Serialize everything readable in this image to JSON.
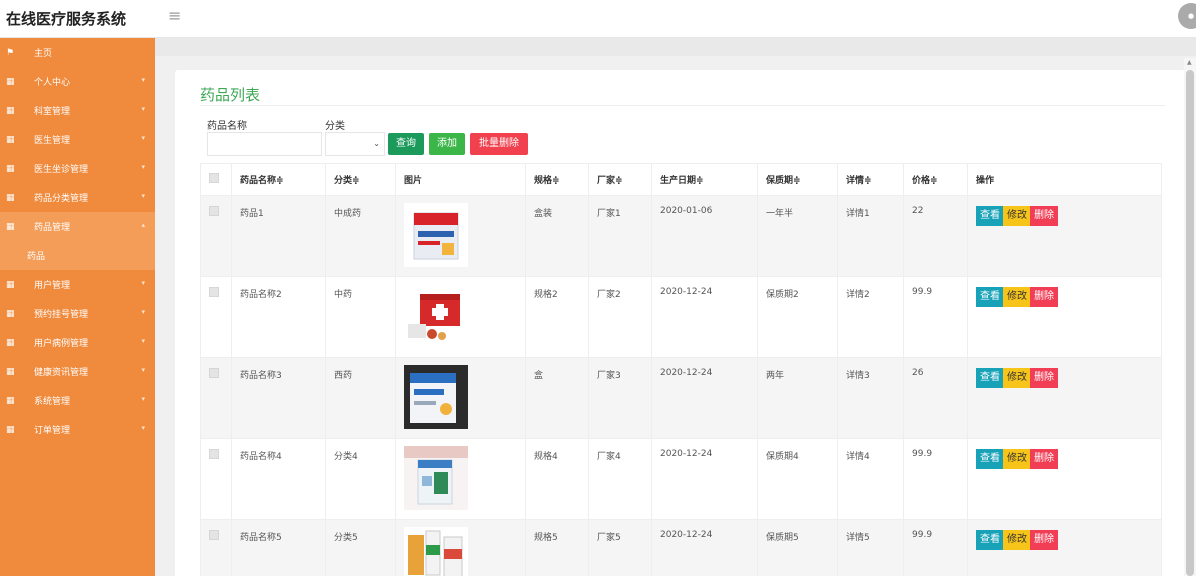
{
  "header": {
    "app_title": "在线医疗服务系统",
    "menu_icon": "hamburger-icon"
  },
  "sidebar": {
    "items": [
      {
        "label": "主页",
        "icon": "flag-icon"
      },
      {
        "label": "个人中心",
        "icon": "grid-icon"
      },
      {
        "label": "科室管理",
        "icon": "grid-icon"
      },
      {
        "label": "医生管理",
        "icon": "grid-icon"
      },
      {
        "label": "医生坐诊管理",
        "icon": "grid-icon"
      },
      {
        "label": "药品分类管理",
        "icon": "grid-icon"
      },
      {
        "label": "药品管理",
        "icon": "grid-icon",
        "expanded": true,
        "sub": [
          "药品"
        ]
      },
      {
        "label": "用户管理",
        "icon": "grid-icon"
      },
      {
        "label": "预约挂号管理",
        "icon": "grid-icon"
      },
      {
        "label": "用户病例管理",
        "icon": "grid-icon"
      },
      {
        "label": "健康资讯管理",
        "icon": "grid-icon"
      },
      {
        "label": "系统管理",
        "icon": "grid-icon"
      },
      {
        "label": "订单管理",
        "icon": "grid-icon"
      }
    ]
  },
  "page": {
    "title": "药品列表",
    "filters": {
      "name_label": "药品名称",
      "name_value": "",
      "category_label": "分类",
      "category_value": ""
    },
    "buttons": {
      "search": "查询",
      "add": "添加",
      "batch_delete": "批量删除"
    }
  },
  "table": {
    "columns": [
      "药品名称",
      "分类",
      "图片",
      "规格",
      "厂家",
      "生产日期",
      "保质期",
      "详情",
      "价格",
      "操作"
    ],
    "sort_marker": "≑",
    "actions": {
      "view": "查看",
      "edit": "修改",
      "delete": "删除"
    },
    "rows": [
      {
        "name": "药品1",
        "category": "中成药",
        "spec": "盒装",
        "maker": "厂家1",
        "date": "2020-01-06",
        "shelf": "一年半",
        "detail": "详情1",
        "price": "22"
      },
      {
        "name": "药品名称2",
        "category": "中药",
        "spec": "规格2",
        "maker": "厂家2",
        "date": "2020-12-24",
        "shelf": "保质期2",
        "detail": "详情2",
        "price": "99.9"
      },
      {
        "name": "药品名称3",
        "category": "西药",
        "spec": "盒",
        "maker": "厂家3",
        "date": "2020-12-24",
        "shelf": "两年",
        "detail": "详情3",
        "price": "26"
      },
      {
        "name": "药品名称4",
        "category": "分类4",
        "spec": "规格4",
        "maker": "厂家4",
        "date": "2020-12-24",
        "shelf": "保质期4",
        "detail": "详情4",
        "price": "99.9"
      },
      {
        "name": "药品名称5",
        "category": "分类5",
        "spec": "规格5",
        "maker": "厂家5",
        "date": "2020-12-24",
        "shelf": "保质期5",
        "detail": "详情5",
        "price": "99.9"
      }
    ]
  },
  "colors": {
    "sidebar": "#f08a3c",
    "title_green": "#3fa856",
    "btn_search": "#1b9a5c",
    "btn_add": "#3cb649",
    "btn_delete": "#f1414f",
    "act_view": "#17a2b8",
    "act_edit": "#f7c41a",
    "act_delete": "#f13e55"
  }
}
